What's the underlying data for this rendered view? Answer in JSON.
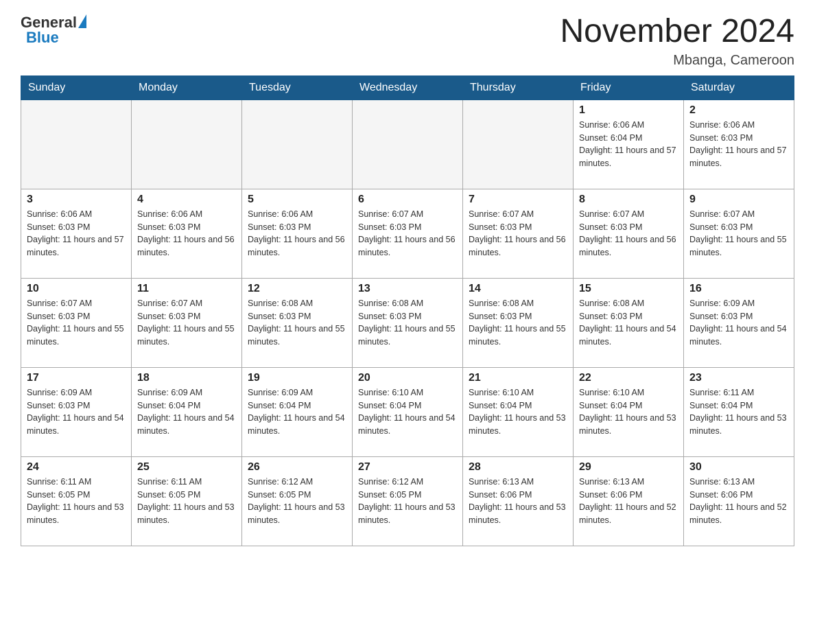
{
  "logo": {
    "general": "General",
    "blue": "Blue"
  },
  "header": {
    "month": "November 2024",
    "location": "Mbanga, Cameroon"
  },
  "weekdays": [
    "Sunday",
    "Monday",
    "Tuesday",
    "Wednesday",
    "Thursday",
    "Friday",
    "Saturday"
  ],
  "weeks": [
    [
      {
        "day": "",
        "info": ""
      },
      {
        "day": "",
        "info": ""
      },
      {
        "day": "",
        "info": ""
      },
      {
        "day": "",
        "info": ""
      },
      {
        "day": "",
        "info": ""
      },
      {
        "day": "1",
        "info": "Sunrise: 6:06 AM\nSunset: 6:04 PM\nDaylight: 11 hours and 57 minutes."
      },
      {
        "day": "2",
        "info": "Sunrise: 6:06 AM\nSunset: 6:03 PM\nDaylight: 11 hours and 57 minutes."
      }
    ],
    [
      {
        "day": "3",
        "info": "Sunrise: 6:06 AM\nSunset: 6:03 PM\nDaylight: 11 hours and 57 minutes."
      },
      {
        "day": "4",
        "info": "Sunrise: 6:06 AM\nSunset: 6:03 PM\nDaylight: 11 hours and 56 minutes."
      },
      {
        "day": "5",
        "info": "Sunrise: 6:06 AM\nSunset: 6:03 PM\nDaylight: 11 hours and 56 minutes."
      },
      {
        "day": "6",
        "info": "Sunrise: 6:07 AM\nSunset: 6:03 PM\nDaylight: 11 hours and 56 minutes."
      },
      {
        "day": "7",
        "info": "Sunrise: 6:07 AM\nSunset: 6:03 PM\nDaylight: 11 hours and 56 minutes."
      },
      {
        "day": "8",
        "info": "Sunrise: 6:07 AM\nSunset: 6:03 PM\nDaylight: 11 hours and 56 minutes."
      },
      {
        "day": "9",
        "info": "Sunrise: 6:07 AM\nSunset: 6:03 PM\nDaylight: 11 hours and 55 minutes."
      }
    ],
    [
      {
        "day": "10",
        "info": "Sunrise: 6:07 AM\nSunset: 6:03 PM\nDaylight: 11 hours and 55 minutes."
      },
      {
        "day": "11",
        "info": "Sunrise: 6:07 AM\nSunset: 6:03 PM\nDaylight: 11 hours and 55 minutes."
      },
      {
        "day": "12",
        "info": "Sunrise: 6:08 AM\nSunset: 6:03 PM\nDaylight: 11 hours and 55 minutes."
      },
      {
        "day": "13",
        "info": "Sunrise: 6:08 AM\nSunset: 6:03 PM\nDaylight: 11 hours and 55 minutes."
      },
      {
        "day": "14",
        "info": "Sunrise: 6:08 AM\nSunset: 6:03 PM\nDaylight: 11 hours and 55 minutes."
      },
      {
        "day": "15",
        "info": "Sunrise: 6:08 AM\nSunset: 6:03 PM\nDaylight: 11 hours and 54 minutes."
      },
      {
        "day": "16",
        "info": "Sunrise: 6:09 AM\nSunset: 6:03 PM\nDaylight: 11 hours and 54 minutes."
      }
    ],
    [
      {
        "day": "17",
        "info": "Sunrise: 6:09 AM\nSunset: 6:03 PM\nDaylight: 11 hours and 54 minutes."
      },
      {
        "day": "18",
        "info": "Sunrise: 6:09 AM\nSunset: 6:04 PM\nDaylight: 11 hours and 54 minutes."
      },
      {
        "day": "19",
        "info": "Sunrise: 6:09 AM\nSunset: 6:04 PM\nDaylight: 11 hours and 54 minutes."
      },
      {
        "day": "20",
        "info": "Sunrise: 6:10 AM\nSunset: 6:04 PM\nDaylight: 11 hours and 54 minutes."
      },
      {
        "day": "21",
        "info": "Sunrise: 6:10 AM\nSunset: 6:04 PM\nDaylight: 11 hours and 53 minutes."
      },
      {
        "day": "22",
        "info": "Sunrise: 6:10 AM\nSunset: 6:04 PM\nDaylight: 11 hours and 53 minutes."
      },
      {
        "day": "23",
        "info": "Sunrise: 6:11 AM\nSunset: 6:04 PM\nDaylight: 11 hours and 53 minutes."
      }
    ],
    [
      {
        "day": "24",
        "info": "Sunrise: 6:11 AM\nSunset: 6:05 PM\nDaylight: 11 hours and 53 minutes."
      },
      {
        "day": "25",
        "info": "Sunrise: 6:11 AM\nSunset: 6:05 PM\nDaylight: 11 hours and 53 minutes."
      },
      {
        "day": "26",
        "info": "Sunrise: 6:12 AM\nSunset: 6:05 PM\nDaylight: 11 hours and 53 minutes."
      },
      {
        "day": "27",
        "info": "Sunrise: 6:12 AM\nSunset: 6:05 PM\nDaylight: 11 hours and 53 minutes."
      },
      {
        "day": "28",
        "info": "Sunrise: 6:13 AM\nSunset: 6:06 PM\nDaylight: 11 hours and 53 minutes."
      },
      {
        "day": "29",
        "info": "Sunrise: 6:13 AM\nSunset: 6:06 PM\nDaylight: 11 hours and 52 minutes."
      },
      {
        "day": "30",
        "info": "Sunrise: 6:13 AM\nSunset: 6:06 PM\nDaylight: 11 hours and 52 minutes."
      }
    ]
  ]
}
